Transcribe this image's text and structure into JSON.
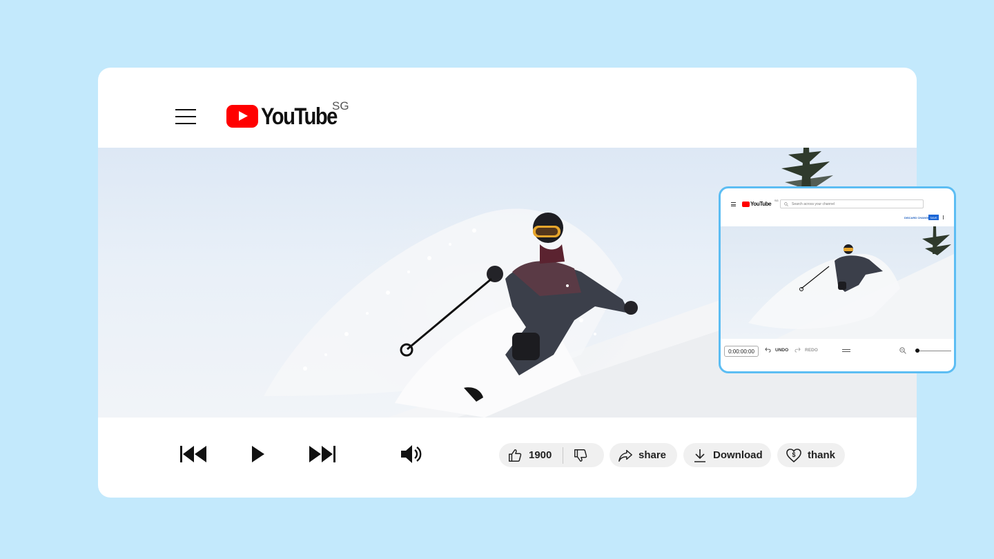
{
  "header": {
    "logo_text": "YouTube",
    "region": "SG"
  },
  "actions": {
    "likes": "1900",
    "share_label": "share",
    "download_label": "Download",
    "thanks_label": "thank"
  },
  "inset": {
    "logo_text": "YouTube",
    "region": "SG",
    "search_placeholder": "Search across your channel",
    "discard_label": "DISCARD CHANGES",
    "save_label": "SAVE",
    "timecode": "0:00:00:00",
    "undo_label": "UNDO",
    "redo_label": "REDO"
  },
  "colors": {
    "background": "#c3e9fc",
    "brand_red": "#ff0000",
    "inset_border": "#5cbdf3",
    "save_blue": "#1a66d6"
  },
  "icons": [
    "menu-icon",
    "previous-icon",
    "play-icon",
    "next-icon",
    "volume-icon",
    "thumbs-up-icon",
    "thumbs-down-icon",
    "share-icon",
    "download-icon",
    "thanks-icon",
    "undo-icon",
    "redo-icon",
    "zoom-out-icon"
  ]
}
